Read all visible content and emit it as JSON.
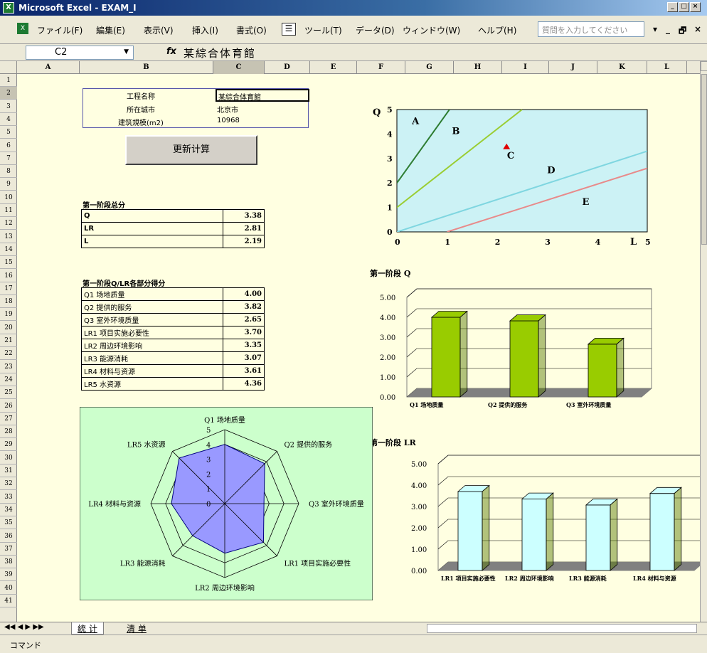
{
  "window": {
    "title": "Microsoft Excel - EXAM_I",
    "min": "_",
    "restore": "□",
    "close": "×"
  },
  "menu": {
    "items": [
      "ファイル(F)",
      "編集(E)",
      "表示(V)",
      "挿入(I)",
      "書式(O)",
      "ツール(T)",
      "データ(D)",
      "ウィンドウ(W)",
      "ヘルプ(H)"
    ],
    "question_placeholder": "質問を入力してください",
    "doc_controls": [
      "▾",
      "_",
      "🗗",
      "×"
    ]
  },
  "formula": {
    "namebox": "C2",
    "fx": "fx",
    "value": "某綜合体育館"
  },
  "columns": [
    "A",
    "B",
    "C",
    "D",
    "E",
    "F",
    "G",
    "H",
    "I",
    "J",
    "K",
    "L"
  ],
  "rows": [
    "1",
    "2",
    "3",
    "4",
    "5",
    "6",
    "7",
    "8",
    "9",
    "10",
    "11",
    "12",
    "13",
    "14",
    "15",
    "16",
    "17",
    "18",
    "19",
    "20",
    "21",
    "22",
    "23",
    "24",
    "25",
    "26",
    "27",
    "28",
    "29",
    "30",
    "31",
    "32",
    "33",
    "34",
    "35",
    "36",
    "37",
    "38",
    "39",
    "40",
    "41"
  ],
  "project": {
    "name_label": "工程名称",
    "name_value": "某綜合体育館",
    "city_label": "所在城市",
    "city_value": "北京市",
    "scale_label": "建筑規模(m2)",
    "scale_value": "10968"
  },
  "update_button": "更新计算",
  "stage1": {
    "title": "第一阶段总分",
    "rows": [
      {
        "label": "Q",
        "value": "3.38"
      },
      {
        "label": "LR",
        "value": "2.81"
      },
      {
        "label": "L",
        "value": "2.19"
      }
    ]
  },
  "stage1_parts": {
    "title": "第一阶段Q/LR各部分得分",
    "rows": [
      {
        "label": "Q1 场地质量",
        "value": "4.00"
      },
      {
        "label": "Q2 提供的服务",
        "value": "3.82"
      },
      {
        "label": "Q3 室外环境质量",
        "value": "2.65"
      },
      {
        "label": "LR1 项目实施必要性",
        "value": "3.70"
      },
      {
        "label": "LR2 周边环境影响",
        "value": "3.35"
      },
      {
        "label": "LR3 能源消耗",
        "value": "3.07"
      },
      {
        "label": "LR4 材料与资源",
        "value": "3.61"
      },
      {
        "label": "LR5 水资源",
        "value": "4.36"
      }
    ]
  },
  "sheet_tabs": {
    "nav": "◀◀ ◀ ▶ ▶▶",
    "active": "統 计",
    "other": "清 单"
  },
  "status_text": "コマンド",
  "chart_data": [
    {
      "type": "line",
      "title": "",
      "xlabel": "L",
      "ylabel": "Q",
      "xlim": [
        0,
        5
      ],
      "ylim": [
        0,
        5
      ],
      "x_ticks": [
        "0",
        "1",
        "2",
        "3",
        "4",
        "5"
      ],
      "y_ticks": [
        "0",
        "1",
        "2",
        "3",
        "4",
        "5"
      ],
      "background": "#ccf2f5",
      "series": [
        {
          "color": "#2e7d32",
          "points": [
            [
              0,
              2
            ],
            [
              1.05,
              5
            ]
          ]
        },
        {
          "color": "#9acd32",
          "points": [
            [
              0,
              1
            ],
            [
              2.5,
              5
            ]
          ]
        },
        {
          "color": "#7fd6e0",
          "points": [
            [
              0,
              0
            ],
            [
              5,
              3.3
            ]
          ]
        },
        {
          "color": "#e88a8a",
          "points": [
            [
              1,
              0
            ],
            [
              5,
              2.6
            ]
          ]
        }
      ],
      "region_labels": [
        {
          "text": "A",
          "x": 0.3,
          "y": 4.4
        },
        {
          "text": "B",
          "x": 1.1,
          "y": 4.0
        },
        {
          "text": "C",
          "x": 2.2,
          "y": 3.0
        },
        {
          "text": "D",
          "x": 3.0,
          "y": 2.4
        },
        {
          "text": "E",
          "x": 3.7,
          "y": 1.1
        }
      ],
      "marker": {
        "x": 2.19,
        "y": 3.38,
        "color": "#e00000"
      }
    },
    {
      "type": "bar",
      "title": "第一阶段 Q",
      "categories": [
        "Q1 场地质量",
        "Q2 提供的服务",
        "Q3 室外环境质量"
      ],
      "values": [
        4.0,
        3.82,
        2.65
      ],
      "ylim": [
        0,
        5
      ],
      "y_ticks": [
        "0.00",
        "1.00",
        "2.00",
        "3.00",
        "4.00",
        "5.00"
      ],
      "color": "#99cc00"
    },
    {
      "type": "bar",
      "title": "第一阶段 LR",
      "categories": [
        "LR1 项目实施必要性",
        "LR2 周边环境影响",
        "LR3 能源消耗",
        "LR4 材料与资源"
      ],
      "values": [
        3.7,
        3.35,
        3.07,
        3.61
      ],
      "ylim": [
        0,
        5
      ],
      "y_ticks": [
        "0.00",
        "1.00",
        "2.00",
        "3.00",
        "4.00",
        "5.00"
      ],
      "color": "#ccffff"
    },
    {
      "type": "radar",
      "categories": [
        "Q1 场地质量",
        "Q2 提供的服务",
        "Q3 室外环境质量",
        "LR1 项目实施必要性",
        "LR2 周边环境影响",
        "LR3 能源消耗",
        "LR4 材料与资源",
        "LR5 水资源"
      ],
      "values": [
        4.0,
        3.82,
        2.65,
        3.7,
        3.35,
        3.07,
        3.61,
        4.36
      ],
      "rlim": [
        0,
        5
      ],
      "r_ticks": [
        "0",
        "1",
        "2",
        "3",
        "4",
        "5"
      ],
      "fill": "#9999ff",
      "background": "#ccffcc"
    }
  ]
}
